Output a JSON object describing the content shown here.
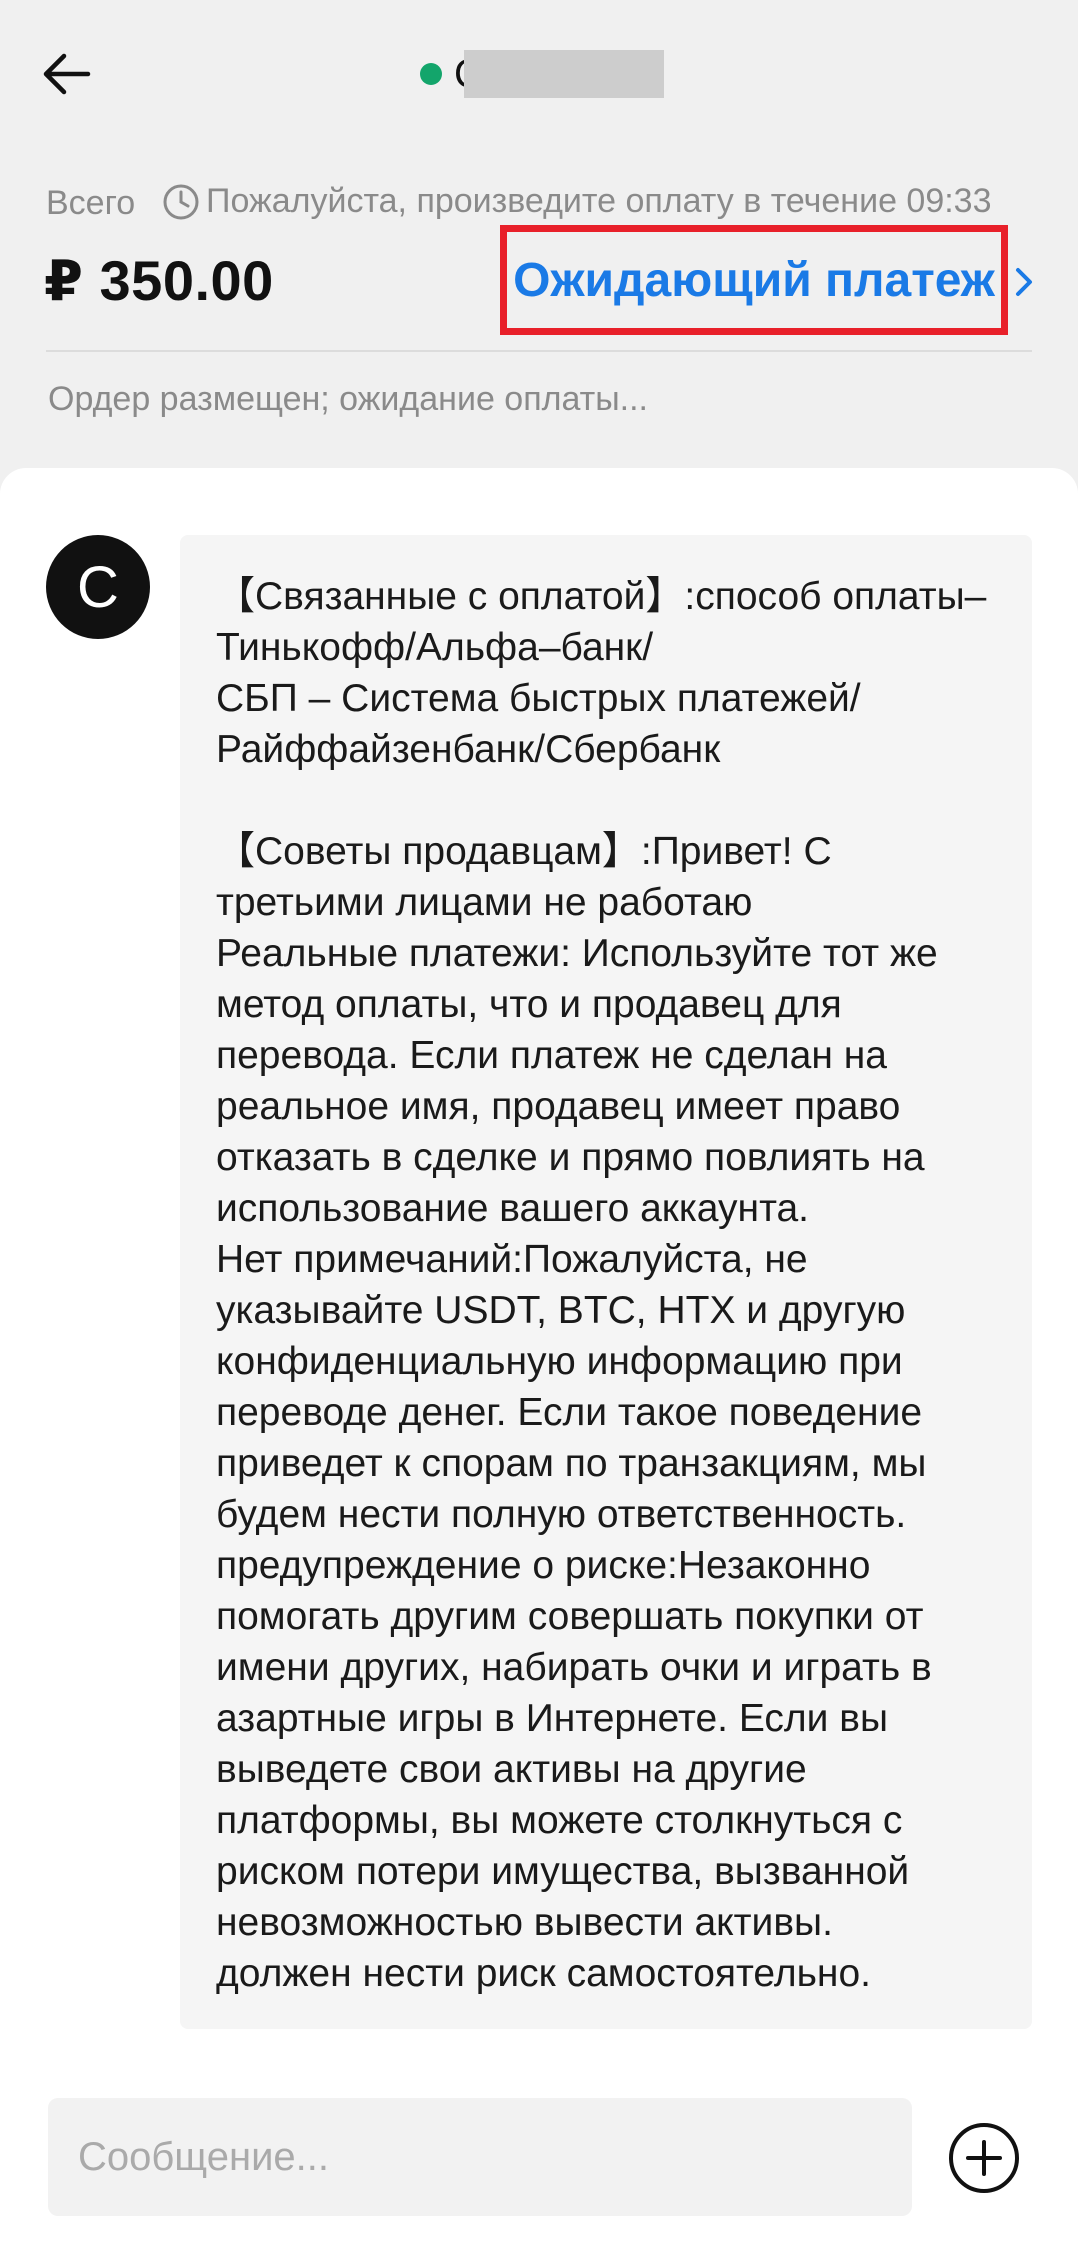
{
  "header": {
    "contact_initial": "С",
    "total_label": "Всего",
    "timer_text": "Пожалуйста, произведите оплату в течение 09:33",
    "amount": "₽ 350.00",
    "pending_link": "Ожидающий платеж",
    "status": "Ордер размещен; ожидание оплаты...",
    "online_color": "#13a56b",
    "accent_color": "#1a7ae6",
    "highlight_color": "#e8202a"
  },
  "chat": {
    "avatar_letter": "C",
    "message": "【Связанные с оплатой】:способ оплаты–Тинькофф/Альфа–банк/\nСБП – Система быстрых платежей/\nРайффайзенбанк/Сбербанк\n\n【Советы продавцам】:Привет! С третьими лицами не работаю\nРеальные платежи: Используйте тот же метод оплаты, что и продавец для перевода. Если платеж не сделан на реальное имя, продавец имеет право отказать в сделке и прямо повлиять на использование вашего аккаунта.\nНет примечаний:Пожалуйста, не указывайте USDT, BTC, HTX и другую конфиденциальную информацию при переводе денег. Если такое поведение приведет к спорам по транзакциям, мы будем нести полную ответственность.\nпредупреждение о риске:Незаконно помогать другим совершать покупки от имени других, набирать очки и играть в азартные игры в Интернете. Если вы выведете свои активы на другие платформы, вы можете столкнуться с риском потери имущества, вызванной невозможностью вывести активы.\nдолжен нести риск самостоятельно."
  },
  "composer": {
    "placeholder": "Сообщение..."
  },
  "icons": {
    "back": "arrow-left-icon",
    "clock": "clock-icon",
    "chevron": "chevron-right-icon",
    "plus": "plus-circle-icon"
  }
}
